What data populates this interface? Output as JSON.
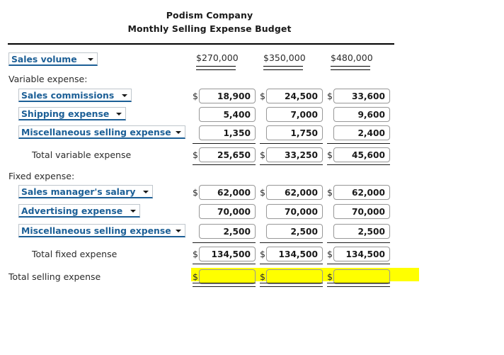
{
  "header": {
    "company": "Podism Company",
    "report_title": "Monthly Selling Expense Budget"
  },
  "colors": {
    "dropdown_text": "#1c5f96",
    "dropdown_underline": "#1c5f96",
    "highlight": "#ffff00",
    "rule": "#000000"
  },
  "columns": [
    {
      "id": "col1",
      "header_value": "$270,000"
    },
    {
      "id": "col2",
      "header_value": "$350,000"
    },
    {
      "id": "col3",
      "header_value": "$480,000"
    }
  ],
  "rows": {
    "sales_volume": {
      "label": "Sales volume",
      "type": "dropdown",
      "values": [
        "$270,000",
        "$350,000",
        "$480,000"
      ]
    },
    "variable_expense_heading": {
      "label": "Variable expense:"
    },
    "sales_commissions": {
      "label": "Sales commissions",
      "type": "dropdown",
      "dollar_signs": [
        "$",
        "$",
        "$"
      ],
      "values": [
        "18,900",
        "24,500",
        "33,600"
      ]
    },
    "shipping_expense": {
      "label": "Shipping expense",
      "type": "dropdown",
      "dollar_signs": [
        "",
        "",
        ""
      ],
      "values": [
        "5,400",
        "7,000",
        "9,600"
      ]
    },
    "misc_selling_expense_variable": {
      "label": "Miscellaneous selling expense",
      "type": "dropdown",
      "dollar_signs": [
        "",
        "",
        ""
      ],
      "values": [
        "1,350",
        "1,750",
        "2,400"
      ]
    },
    "total_variable_expense": {
      "label": "Total variable expense",
      "dollar_signs": [
        "$",
        "$",
        "$"
      ],
      "values": [
        "25,650",
        "33,250",
        "45,600"
      ]
    },
    "fixed_expense_heading": {
      "label": "Fixed expense:"
    },
    "sales_manager_salary": {
      "label": "Sales manager's salary",
      "type": "dropdown",
      "dollar_signs": [
        "$",
        "$",
        "$"
      ],
      "values": [
        "62,000",
        "62,000",
        "62,000"
      ]
    },
    "advertising_expense": {
      "label": "Advertising expense",
      "type": "dropdown",
      "dollar_signs": [
        "",
        "",
        ""
      ],
      "values": [
        "70,000",
        "70,000",
        "70,000"
      ]
    },
    "misc_selling_expense_fixed": {
      "label": "Miscellaneous selling expense",
      "type": "dropdown",
      "dollar_signs": [
        "",
        "",
        ""
      ],
      "values": [
        "2,500",
        "2,500",
        "2,500"
      ]
    },
    "total_fixed_expense": {
      "label": "Total fixed expense",
      "dollar_signs": [
        "$",
        "$",
        "$"
      ],
      "values": [
        "134,500",
        "134,500",
        "134,500"
      ]
    },
    "total_selling_expense": {
      "label": "Total selling expense",
      "dollar_signs": [
        "$",
        "$",
        "$"
      ],
      "values": [
        "",
        "",
        ""
      ],
      "highlighted": true
    }
  }
}
